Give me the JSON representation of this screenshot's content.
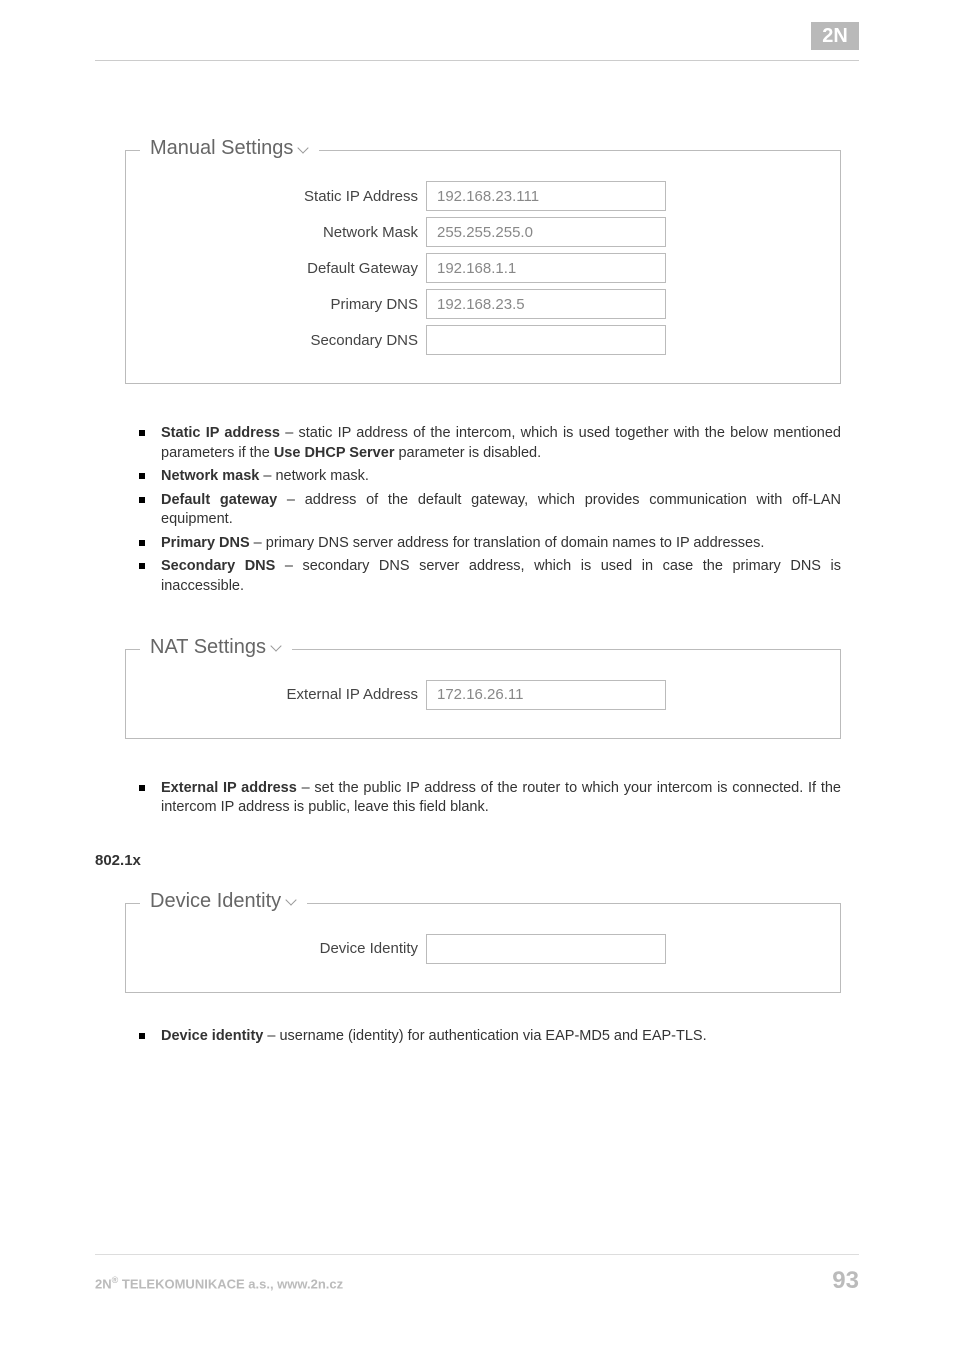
{
  "logo_text": "2N",
  "manual_settings": {
    "legend": "Manual Settings",
    "fields": {
      "static_ip": {
        "label": "Static IP Address",
        "value": "192.168.23.111"
      },
      "netmask": {
        "label": "Network Mask",
        "value": "255.255.255.0"
      },
      "gateway": {
        "label": "Default Gateway",
        "value": "192.168.1.1"
      },
      "dns1": {
        "label": "Primary DNS",
        "value": "192.168.23.5"
      },
      "dns2": {
        "label": "Secondary DNS",
        "value": ""
      }
    }
  },
  "manual_bullets": {
    "b1": {
      "term": "Static IP address",
      "rest": " – static IP address of the intercom, which is used together with the below mentioned parameters if the ",
      "bold2": "Use DHCP Server",
      "rest2": " parameter is disabled."
    },
    "b2": {
      "term": "Network mask",
      "rest": " – network mask."
    },
    "b3": {
      "term": "Default gateway",
      "rest": " – address of the default gateway, which provides communication with off-LAN equipment."
    },
    "b4": {
      "term": "Primary DNS",
      "rest": " – primary DNS server address for translation of domain names to IP addresses."
    },
    "b5": {
      "term": "Secondary DNS",
      "rest": " – secondary DNS server address, which is used in case the primary DNS is inaccessible."
    }
  },
  "nat_settings": {
    "legend": "NAT Settings",
    "fields": {
      "ext_ip": {
        "label": "External IP Address",
        "value": "172.16.26.11"
      }
    }
  },
  "nat_bullets": {
    "b1": {
      "term": "External IP address",
      "rest": " – set the public IP address of the router to which your intercom is connected. If the intercom IP address is public, leave this field blank."
    }
  },
  "section_8021x": "802.1x",
  "device_identity": {
    "legend": "Device Identity",
    "fields": {
      "dev_id": {
        "label": "Device Identity",
        "value": ""
      }
    }
  },
  "dev_bullets": {
    "b1": {
      "term": "Device identity",
      "rest": " – username (identity) for authentication via EAP-MD5 and EAP-TLS."
    }
  },
  "footer": {
    "company_prefix": "2N",
    "company_sup": "®",
    "company_rest": " TELEKOMUNIKACE a.s., www.2n.cz",
    "page": "93"
  }
}
